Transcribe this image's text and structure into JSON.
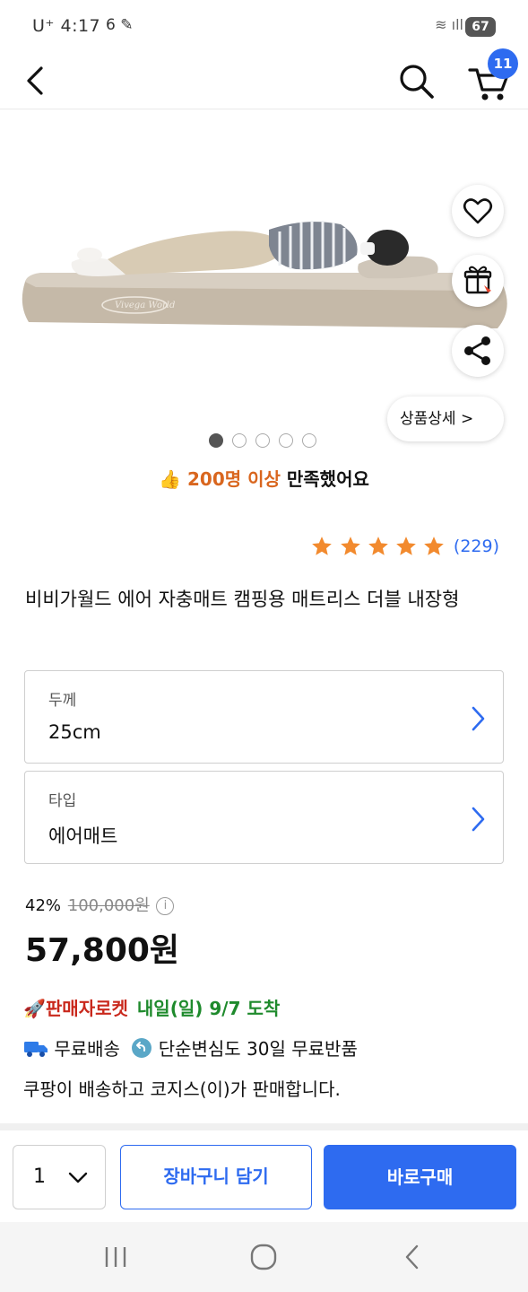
{
  "status_bar": {
    "time": "U⁺ 4:17",
    "left_icons": "6 ✎",
    "right_icons": "≋ ıll",
    "battery": "67"
  },
  "header": {
    "cart_count": "11"
  },
  "gallery": {
    "detail_button": "상품상세 >",
    "page_count": 5,
    "active_page": 1
  },
  "satisfaction": {
    "emoji": "👍",
    "highlight": "200명 이상",
    "text": " 만족했어요"
  },
  "rating": {
    "stars": 5,
    "count": "(229)"
  },
  "product": {
    "title": "비비가월드 에어 자충매트 캠핑용 매트리스 더블 내장형"
  },
  "options": [
    {
      "label": "두께",
      "value": "25cm"
    },
    {
      "label": "타입",
      "value": "에어매트"
    }
  ],
  "pricing": {
    "discount_rate": "42%",
    "original_price": "100,000원",
    "sale_price": "57,800원"
  },
  "delivery": {
    "rocket_label": "🚀판매자로켓",
    "arrival": "내일(일) 9/7 도착",
    "shipping": "무료배송",
    "returns": "단순변심도 30일 무료반품",
    "seller": "쿠팡이 배송하고 코지스(이)가 판매합니다."
  },
  "buy_bar": {
    "quantity": "1",
    "add_to_cart": "장바구니 담기",
    "buy_now": "바로구매"
  },
  "colors": {
    "accent": "#2e6bf0",
    "rocket": "#c9281c",
    "arrival": "#1e8a2c",
    "star": "#f28a2e",
    "satisfaction_highlight": "#d9661e"
  }
}
